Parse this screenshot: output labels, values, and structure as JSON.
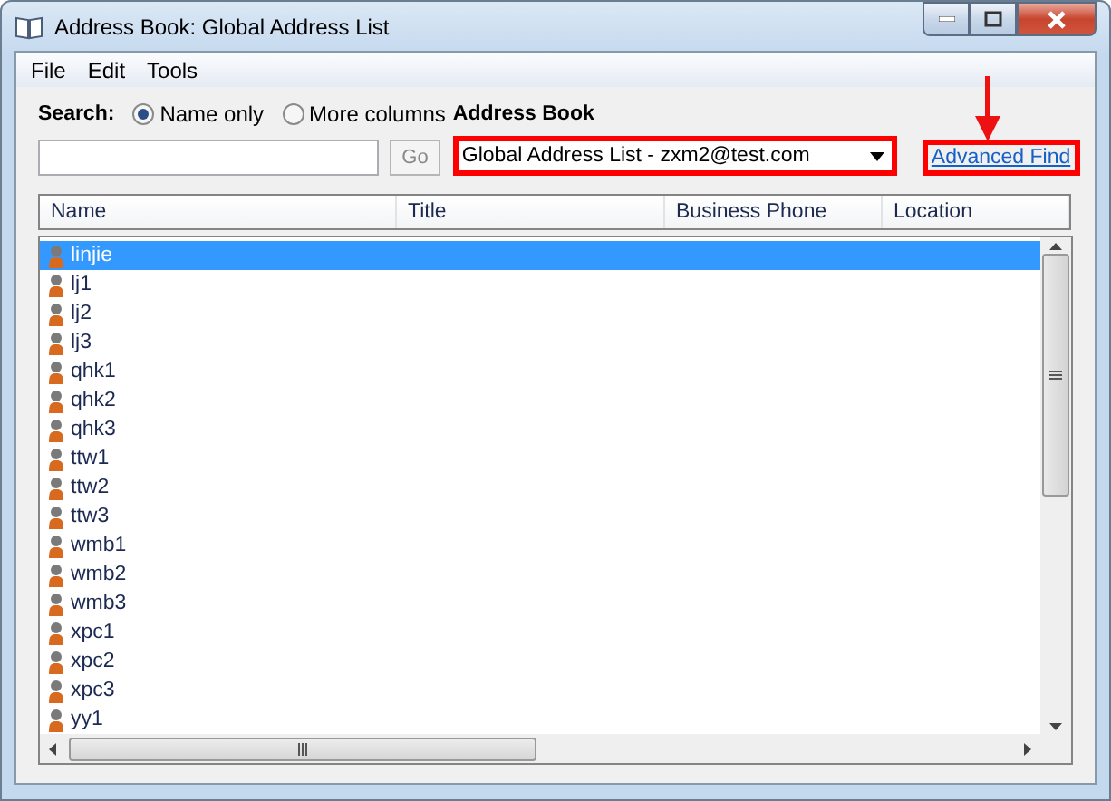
{
  "window": {
    "title": "Address Book: Global Address List"
  },
  "menu": [
    "File",
    "Edit",
    "Tools"
  ],
  "search": {
    "label": "Search:",
    "options": [
      {
        "label": "Name only",
        "selected": true
      },
      {
        "label": "More columns",
        "selected": false
      }
    ],
    "button": "Go"
  },
  "address_book": {
    "label": "Address Book",
    "value": "Global Address List - zxm2@test.com",
    "highlighted": true
  },
  "advanced_find": {
    "label": "Advanced Find",
    "highlighted": true
  },
  "table": {
    "columns": [
      "Name",
      "Title",
      "Business Phone",
      "Location"
    ],
    "rows": [
      {
        "name": "linjie",
        "selected": true
      },
      {
        "name": "lj1",
        "selected": false
      },
      {
        "name": "lj2",
        "selected": false
      },
      {
        "name": "lj3",
        "selected": false
      },
      {
        "name": "qhk1",
        "selected": false
      },
      {
        "name": "qhk2",
        "selected": false
      },
      {
        "name": "qhk3",
        "selected": false
      },
      {
        "name": "ttw1",
        "selected": false
      },
      {
        "name": "ttw2",
        "selected": false
      },
      {
        "name": "ttw3",
        "selected": false
      },
      {
        "name": "wmb1",
        "selected": false
      },
      {
        "name": "wmb2",
        "selected": false
      },
      {
        "name": "wmb3",
        "selected": false
      },
      {
        "name": "xpc1",
        "selected": false
      },
      {
        "name": "xpc2",
        "selected": false
      },
      {
        "name": "xpc3",
        "selected": false
      },
      {
        "name": "yy1",
        "selected": false
      }
    ]
  }
}
